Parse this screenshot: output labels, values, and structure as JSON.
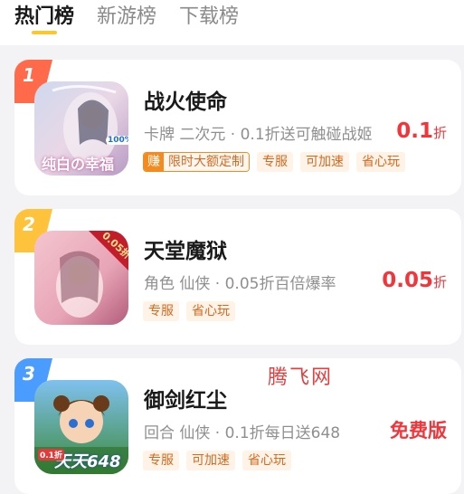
{
  "tabs": [
    {
      "label": "热门榜",
      "active": true
    },
    {
      "label": "新游榜",
      "active": false
    },
    {
      "label": "下载榜",
      "active": false
    }
  ],
  "games": [
    {
      "rank": "1",
      "rank_color": "#ff6a4a",
      "title": "战火使命",
      "subtitle": "卡牌 二次元 · 0.1折送可触碰战姬",
      "earn_badge": "赚",
      "earn_text": "限时大额定制",
      "tags": [
        "专服",
        "可加速",
        "省心玩"
      ],
      "price_value": "0.1",
      "price_unit": "折",
      "icon_text": "纯白の幸福",
      "icon_badge": "100%"
    },
    {
      "rank": "2",
      "rank_color": "#ffc23a",
      "title": "天堂魔狱",
      "subtitle": "角色 仙侠 · 0.05折百倍爆率",
      "tags": [
        "专服",
        "省心玩"
      ],
      "price_value": "0.05",
      "price_unit": "折",
      "icon_badge": "0.05折"
    },
    {
      "rank": "3",
      "rank_color": "#4a9cff",
      "title": "御剑红尘",
      "subtitle": "回合 仙侠 · 0.1折每日送648",
      "tags": [
        "专服",
        "可加速",
        "省心玩"
      ],
      "price_label": "免费版",
      "icon_text": "天天648",
      "icon_badge": "0.1折"
    }
  ],
  "watermark": "腾飞网",
  "colors": {
    "accent": "#ffc62a",
    "price": "#f2353b",
    "tag_text": "#d26a22",
    "tag_bg": "#fff3e7"
  }
}
